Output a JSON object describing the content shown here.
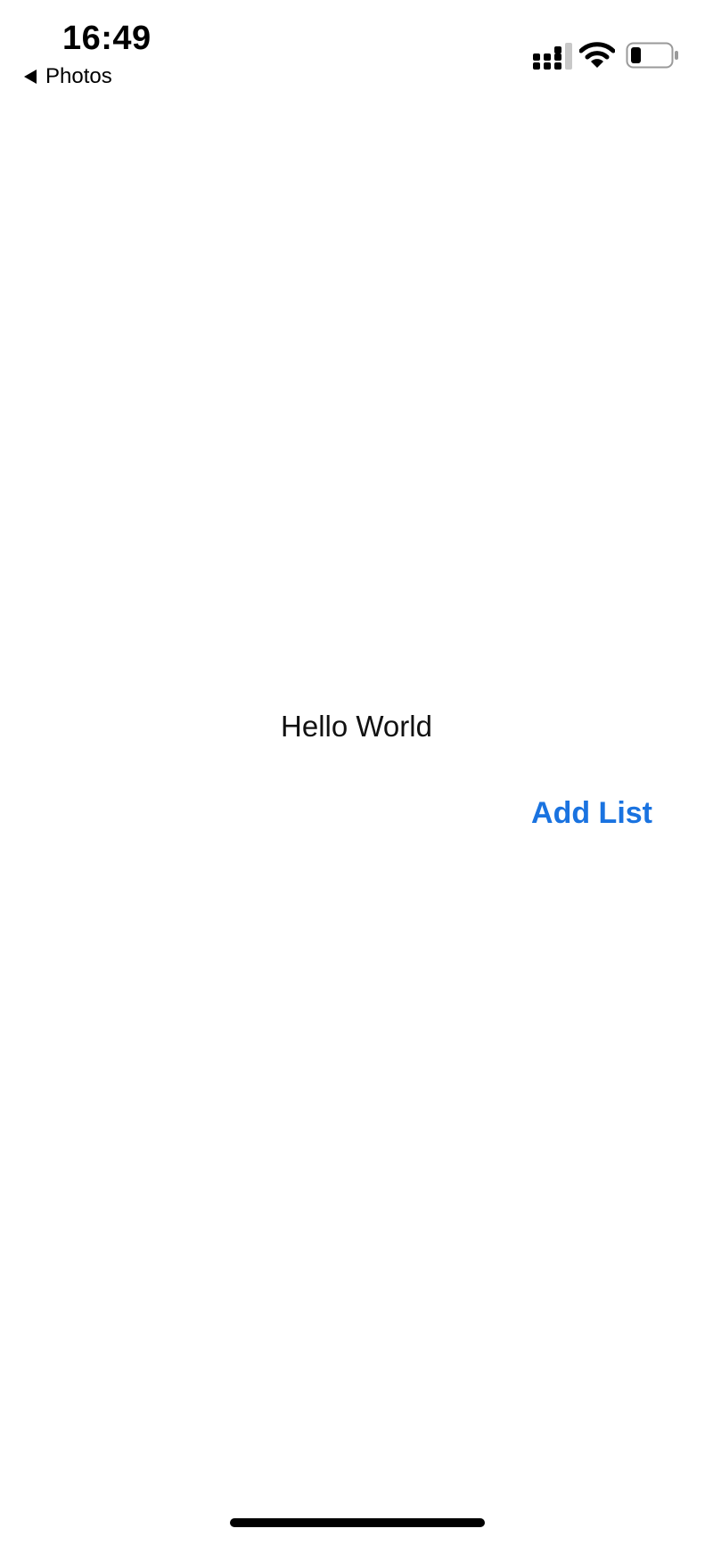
{
  "status_bar": {
    "time": "16:49",
    "back_label": "Photos",
    "icons": {
      "back": "back-triangle-icon",
      "signal": "cellular-signal-icon",
      "wifi": "wifi-icon",
      "battery": "battery-icon"
    },
    "battery_level": 0.25
  },
  "main": {
    "hello_text": "Hello World",
    "add_list_label": "Add List"
  },
  "colors": {
    "accent": "#1a73e0",
    "background": "#ffffff",
    "text": "#111111"
  }
}
